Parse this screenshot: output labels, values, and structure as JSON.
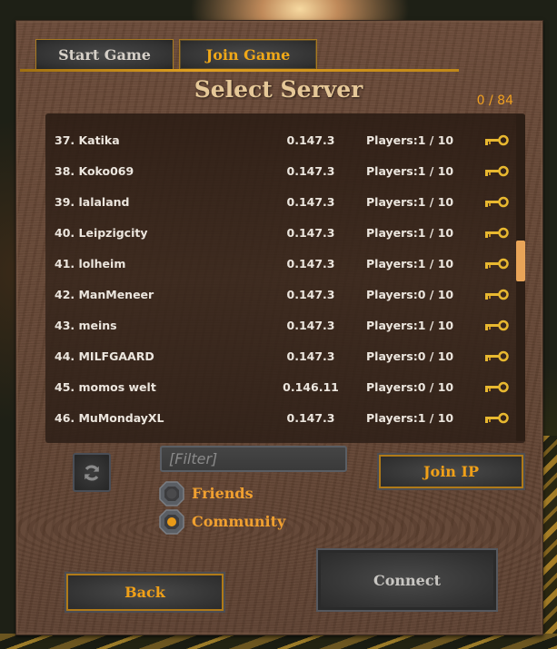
{
  "tabs": [
    {
      "label": "Start Game",
      "active": false
    },
    {
      "label": "Join Game",
      "active": true
    }
  ],
  "title": "Select Server",
  "server_count": "0 / 84",
  "servers": [
    {
      "name": "37. Katika",
      "version": "0.147.3",
      "players": "Players:1 / 10",
      "icon": "key-icon"
    },
    {
      "name": "38. Koko069",
      "version": "0.147.3",
      "players": "Players:1 / 10",
      "icon": "key-icon"
    },
    {
      "name": "39. lalaland",
      "version": "0.147.3",
      "players": "Players:1 / 10",
      "icon": "key-icon"
    },
    {
      "name": "40. Leipzigcity",
      "version": "0.147.3",
      "players": "Players:1 / 10",
      "icon": "key-icon"
    },
    {
      "name": "41. lolheim",
      "version": "0.147.3",
      "players": "Players:1 / 10",
      "icon": "key-icon"
    },
    {
      "name": "42. ManMeneer",
      "version": "0.147.3",
      "players": "Players:0 / 10",
      "icon": "key-icon"
    },
    {
      "name": "43. meins",
      "version": "0.147.3",
      "players": "Players:1 / 10",
      "icon": "key-icon"
    },
    {
      "name": "44. MILFGAARD",
      "version": "0.147.3",
      "players": "Players:0 / 10",
      "icon": "key-icon"
    },
    {
      "name": "45. momos welt",
      "version": "0.146.11",
      "players": "Players:0 / 10",
      "icon": "key-icon"
    },
    {
      "name": "46. MuMondayXL",
      "version": "0.147.3",
      "players": "Players:1 / 10",
      "icon": "key-icon"
    }
  ],
  "scroll_position": 0.44,
  "filter": {
    "value": "",
    "placeholder": "[Filter]"
  },
  "refresh_icon": "refresh-icon",
  "radio_options": [
    {
      "label": "Friends",
      "selected": false
    },
    {
      "label": "Community",
      "selected": true
    }
  ],
  "buttons": {
    "join_ip": "Join IP",
    "back": "Back",
    "connect": "Connect"
  },
  "colors": {
    "accent_gold": "#f0a018",
    "title": "#e6c898",
    "key": "#e8b830",
    "scroll_thumb": "#e8a458"
  }
}
